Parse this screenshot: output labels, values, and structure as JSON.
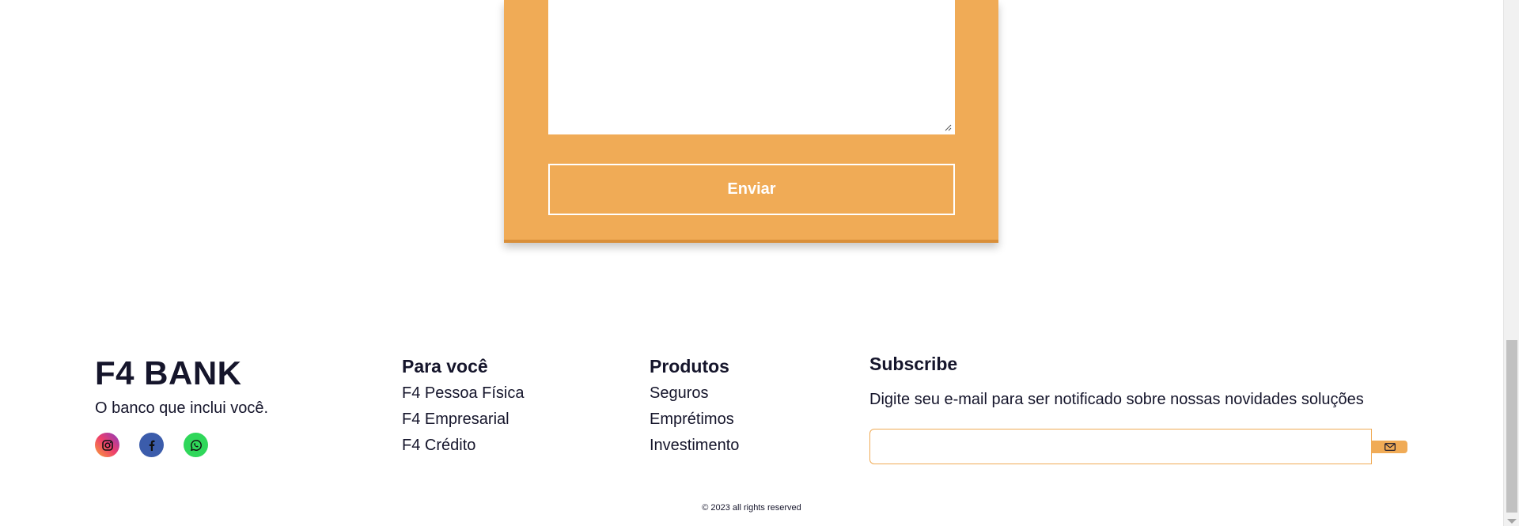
{
  "form": {
    "message_value": "",
    "send_label": "Enviar"
  },
  "footer": {
    "brand": {
      "title": "F4 BANK",
      "tagline": "O banco que inclui você."
    },
    "socials": [
      {
        "icon": "instagram-icon"
      },
      {
        "icon": "facebook-icon"
      },
      {
        "icon": "whatsapp-icon"
      }
    ],
    "para_voce": {
      "title": "Para você",
      "links": [
        "F4 Pessoa Física",
        "F4 Empresarial",
        "F4 Crédito"
      ]
    },
    "produtos": {
      "title": "Produtos",
      "links": [
        "Seguros",
        "Emprétimos",
        "Investimento"
      ]
    },
    "subscribe": {
      "title": "Subscribe",
      "text": "Digite seu e-mail para ser notificado sobre nossas novidades soluções",
      "input_value": "",
      "button_icon": "mail-icon"
    },
    "copyright": "© 2023 all rights reserved"
  },
  "colors": {
    "accent": "#f0ab56",
    "text": "#15152b"
  }
}
